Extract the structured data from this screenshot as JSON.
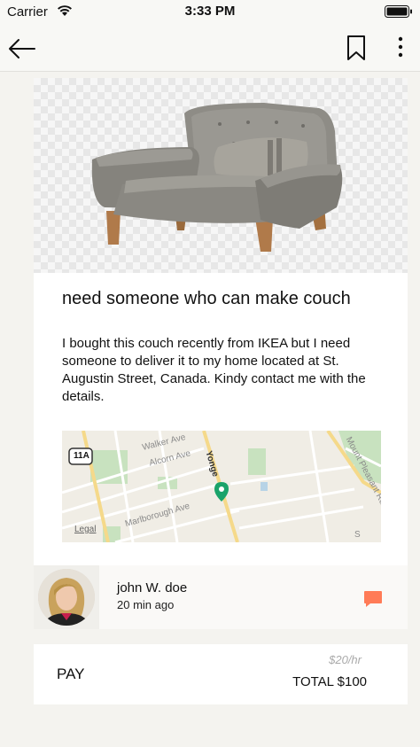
{
  "status_bar": {
    "carrier": "Carrier",
    "time": "3:33 PM",
    "icons": [
      "wifi-icon",
      "battery-icon"
    ]
  },
  "nav": {
    "icons": [
      "back-arrow-icon",
      "bookmark-icon",
      "more-vertical-icon"
    ]
  },
  "post": {
    "image": "gray-armchair-couch",
    "title": "need someone who can make couch",
    "description": "I bought this couch recently from IKEA but I need someone to deliver it to my home located at St. Augustin Street, Canada. Kindy contact me with the details.",
    "map": {
      "labels": {
        "walker": "Walker Ave",
        "alcorn": "Alcorn Ave",
        "yonge": "Yonge",
        "marlborough": "Marlborough Ave",
        "mount_pleasant": "Mount Pleasant Rd",
        "route": "11A",
        "legal": "Legal",
        "s_stub": "S"
      }
    }
  },
  "author": {
    "name": "john W. doe",
    "time": "20 min ago",
    "chat_icon": "chat-bubble-icon"
  },
  "payment": {
    "label": "PAY",
    "rate": "$20/hr",
    "total": "TOTAL $100"
  },
  "colors": {
    "background": "#f4f3ef",
    "card": "#ffffff",
    "chat_accent": "#ff7b57",
    "map_green": "#c8e2bf",
    "map_road": "#f5d98a"
  }
}
